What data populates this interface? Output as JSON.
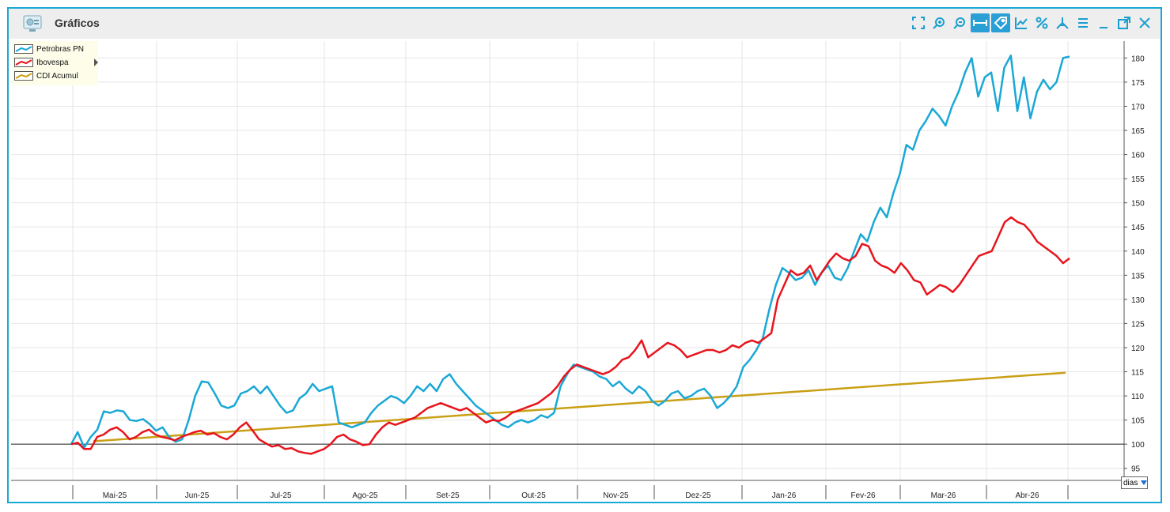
{
  "window": {
    "title": "Gráficos"
  },
  "toolbar": {
    "icons": [
      "fullscreen-icon",
      "zoom-in-icon",
      "zoom-out-icon",
      "fit-horizontal-icon",
      "tag-icon",
      "chart-settings-icon",
      "percent-icon",
      "pdf-icon",
      "menu-icon",
      "minimize-icon",
      "popout-icon",
      "close-icon"
    ]
  },
  "legend": [
    {
      "label": "Petrobras PN",
      "color": "#1aa8d6"
    },
    {
      "label": "Ibovespa",
      "color": "#e8141c"
    },
    {
      "label": "CDI Acumul",
      "color": "#c9a015"
    }
  ],
  "unit_select": {
    "value": "dias"
  },
  "chart_data": {
    "type": "line",
    "x_labels": [
      "Mai-25",
      "Jun-25",
      "Jul-25",
      "Ago-25",
      "Set-25",
      "Out-25",
      "Nov-25",
      "Dez-25",
      "Jan-26",
      "Fev-26",
      "Mar-26",
      "Abr-26"
    ],
    "yticks": [
      95,
      100,
      105,
      110,
      115,
      120,
      125,
      130,
      135,
      140,
      145,
      150,
      155,
      160,
      165,
      170,
      175,
      180
    ],
    "ylim": [
      92.5,
      183.5
    ],
    "baseline": 100,
    "grid": true,
    "legend_position": "top-left",
    "series": [
      {
        "name": "Petrobras PN",
        "color": "#1aa8d6",
        "values": [
          100.0,
          102.5,
          99.3,
          101.5,
          103.0,
          106.8,
          106.5,
          107.0,
          106.8,
          105.0,
          104.8,
          105.2,
          104.2,
          102.8,
          103.5,
          101.5,
          100.5,
          101.0,
          105.0,
          110.0,
          113.0,
          112.8,
          110.5,
          108.0,
          107.5,
          108.0,
          110.5,
          111.0,
          112.0,
          110.5,
          112.0,
          110.0,
          108.0,
          106.5,
          107.0,
          109.5,
          110.5,
          112.5,
          111.0,
          111.5,
          112.0,
          104.5,
          104.0,
          103.5,
          104.0,
          104.5,
          106.5,
          108.0,
          109.0,
          110.0,
          109.5,
          108.5,
          110.0,
          112.0,
          111.0,
          112.5,
          111.0,
          113.5,
          114.5,
          112.5,
          111.0,
          109.5,
          108.0,
          107.0,
          106.0,
          105.0,
          104.0,
          103.5,
          104.5,
          105.0,
          104.5,
          105.0,
          106.0,
          105.5,
          106.5,
          112.0,
          114.5,
          116.5,
          116.0,
          115.5,
          115.0,
          114.0,
          113.5,
          112.0,
          113.0,
          111.5,
          110.5,
          112.0,
          111.0,
          109.0,
          108.0,
          109.0,
          110.5,
          111.0,
          109.5,
          110.0,
          111.0,
          111.5,
          110.0,
          107.5,
          108.5,
          110.0,
          112.0,
          116.0,
          117.5,
          119.5,
          122.0,
          128.0,
          133.0,
          136.5,
          135.5,
          134.0,
          134.5,
          136.0,
          133.0,
          135.5,
          137.0,
          134.5,
          134.0,
          136.5,
          140.0,
          143.5,
          142.0,
          146.0,
          149.0,
          147.0,
          152.0,
          156.0,
          162.0,
          161.0,
          165.0,
          167.0,
          169.5,
          168.0,
          166.0,
          170.0,
          173.0,
          177.0,
          180.0,
          172.0,
          176.0,
          177.0,
          169.0,
          178.0,
          180.5,
          169.0,
          176.0,
          167.5,
          173.0,
          175.5,
          173.5,
          175.0,
          180.0,
          180.3
        ]
      },
      {
        "name": "Ibovespa",
        "color": "#e8141c",
        "values": [
          100.0,
          100.3,
          99.0,
          99.0,
          101.5,
          102.0,
          103.0,
          103.5,
          102.5,
          101.0,
          101.5,
          102.5,
          103.0,
          102.0,
          101.5,
          101.2,
          100.8,
          101.5,
          102.0,
          102.5,
          102.8,
          102.0,
          102.3,
          101.5,
          101.0,
          102.0,
          103.5,
          104.5,
          102.8,
          101.0,
          100.2,
          99.5,
          99.8,
          99.0,
          99.2,
          98.5,
          98.2,
          98.0,
          98.5,
          99.0,
          100.0,
          101.5,
          102.0,
          101.0,
          100.5,
          99.8,
          100.0,
          102.0,
          103.5,
          104.5,
          104.0,
          104.5,
          105.0,
          105.5,
          106.5,
          107.5,
          108.0,
          108.5,
          108.0,
          107.5,
          107.0,
          107.5,
          106.5,
          105.5,
          104.5,
          105.0,
          104.8,
          105.5,
          106.5,
          107.0,
          107.5,
          108.0,
          108.5,
          109.5,
          110.5,
          112.0,
          114.0,
          115.5,
          116.5,
          116.0,
          115.5,
          115.0,
          114.5,
          115.0,
          116.0,
          117.5,
          118.0,
          119.5,
          121.5,
          118.0,
          119.0,
          120.0,
          121.0,
          120.5,
          119.5,
          118.0,
          118.5,
          119.0,
          119.5,
          119.5,
          119.0,
          119.5,
          120.5,
          120.0,
          121.0,
          121.5,
          121.0,
          122.0,
          123.0,
          130.0,
          133.0,
          136.0,
          135.0,
          135.5,
          137.0,
          134.0,
          136.0,
          138.0,
          139.5,
          138.5,
          138.0,
          139.0,
          141.5,
          141.0,
          138.0,
          137.0,
          136.5,
          135.5,
          137.5,
          136.0,
          134.0,
          133.5,
          131.0,
          132.0,
          133.0,
          132.5,
          131.5,
          133.0,
          135.0,
          137.0,
          139.0,
          139.5,
          140.0,
          143.0,
          146.0,
          147.0,
          146.0,
          145.5,
          144.0,
          142.0,
          141.0,
          140.0,
          139.0,
          137.5,
          138.5
        ]
      },
      {
        "name": "CDI Acumul",
        "color": "#c9a015",
        "values": [
          100.0,
          114.8
        ]
      }
    ]
  }
}
